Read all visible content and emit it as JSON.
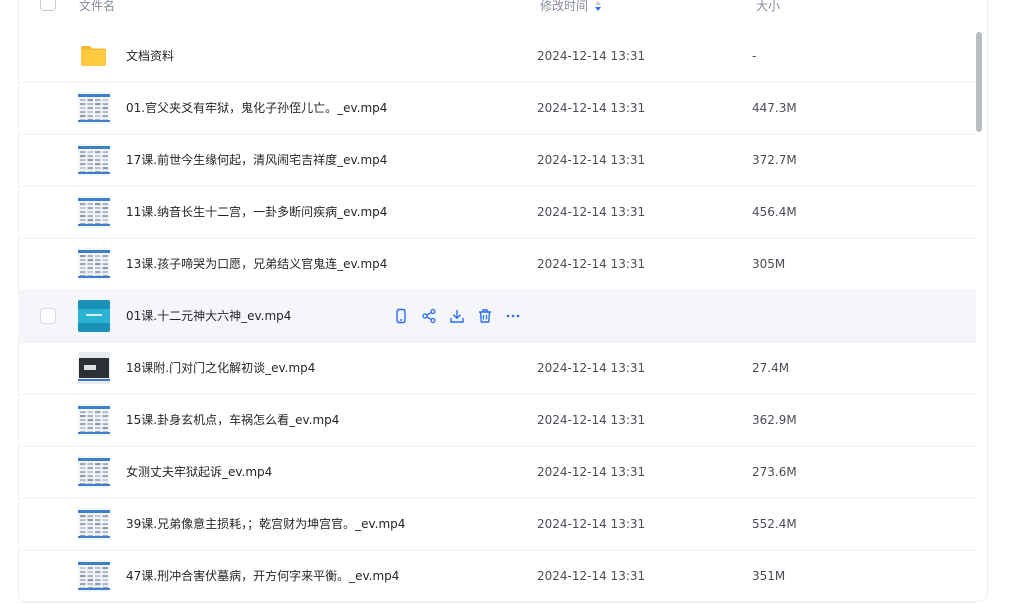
{
  "colors": {
    "accent": "#2a6df4",
    "text": "#25262b",
    "muted": "#878c9c",
    "folder": "#ffc940"
  },
  "header": {
    "name": "文件名",
    "mtime": "修改时间",
    "size": "大小"
  },
  "rows": [
    {
      "name": "文档资料",
      "mtime": "2024-12-14 13:31",
      "size": "-",
      "kind": "folder"
    },
    {
      "name": "01.官父夹爻有牢狱，鬼化子孙侄儿亡。_ev.mp4",
      "mtime": "2024-12-14 13:31",
      "size": "447.3M",
      "kind": "video"
    },
    {
      "name": "17课.前世今生缘何起，清风闹宅吉祥度_ev.mp4",
      "mtime": "2024-12-14 13:31",
      "size": "372.7M",
      "kind": "video"
    },
    {
      "name": "11课.纳音长生十二宫，一卦多断问疾病_ev.mp4",
      "mtime": "2024-12-14 13:31",
      "size": "456.4M",
      "kind": "video"
    },
    {
      "name": "13课.孩子啼哭为口愿，兄弟结义官鬼连_ev.mp4",
      "mtime": "2024-12-14 13:31",
      "size": "305M",
      "kind": "video"
    },
    {
      "name": "01课.十二元神大六神_ev.mp4",
      "mtime": "",
      "size": "",
      "kind": "video",
      "hover": true
    },
    {
      "name": "18课附.门对门之化解初谈_ev.mp4",
      "mtime": "2024-12-14 13:31",
      "size": "27.4M",
      "kind": "video"
    },
    {
      "name": "15课.卦身玄机点，车祸怎么看_ev.mp4",
      "mtime": "2024-12-14 13:31",
      "size": "362.9M",
      "kind": "video"
    },
    {
      "name": "女测丈夫牢狱起诉_ev.mp4",
      "mtime": "2024-12-14 13:31",
      "size": "273.6M",
      "kind": "video"
    },
    {
      "name": "39课.兄弟像意主损耗，；乾宫财为坤宫官。_ev.mp4",
      "mtime": "2024-12-14 13:31",
      "size": "552.4M",
      "kind": "video"
    },
    {
      "name": "47课.刑冲合害伏墓病，开方何字来平衡。_ev.mp4",
      "mtime": "2024-12-14 13:31",
      "size": "351M",
      "kind": "video"
    }
  ],
  "row_actions": [
    "phone-icon",
    "share-icon",
    "download-icon",
    "delete-icon",
    "more-icon"
  ]
}
